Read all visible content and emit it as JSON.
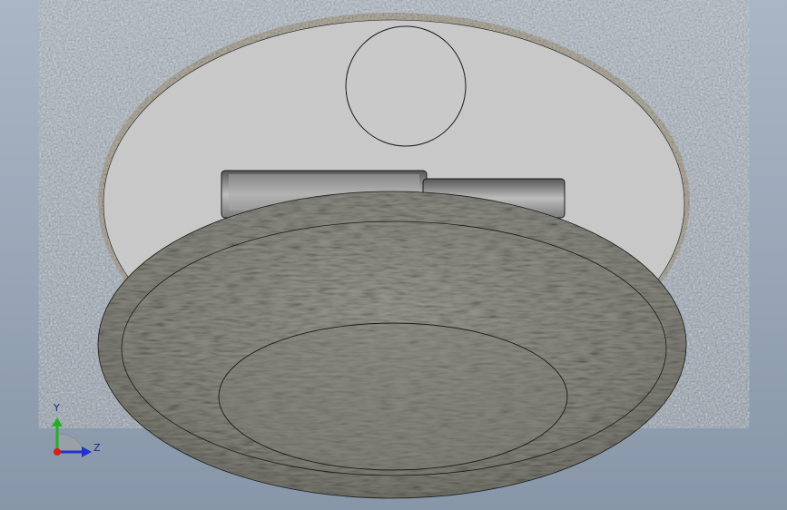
{
  "viewport": {
    "background_top": "#a9b6c5",
    "background_bottom": "#8796a8"
  },
  "model": {
    "housing_face_color": "#c8c8c8",
    "housing_edge_color": "#b8b3a6",
    "cap_color": "#87877f",
    "outline_color": "#1a1a1a"
  },
  "triad": {
    "y_label": "Y",
    "z_label": "Z",
    "y_color": "#22b022",
    "z_color": "#2233cc",
    "origin_color": "#d81e1e",
    "label_color": "#1a2a7a"
  }
}
